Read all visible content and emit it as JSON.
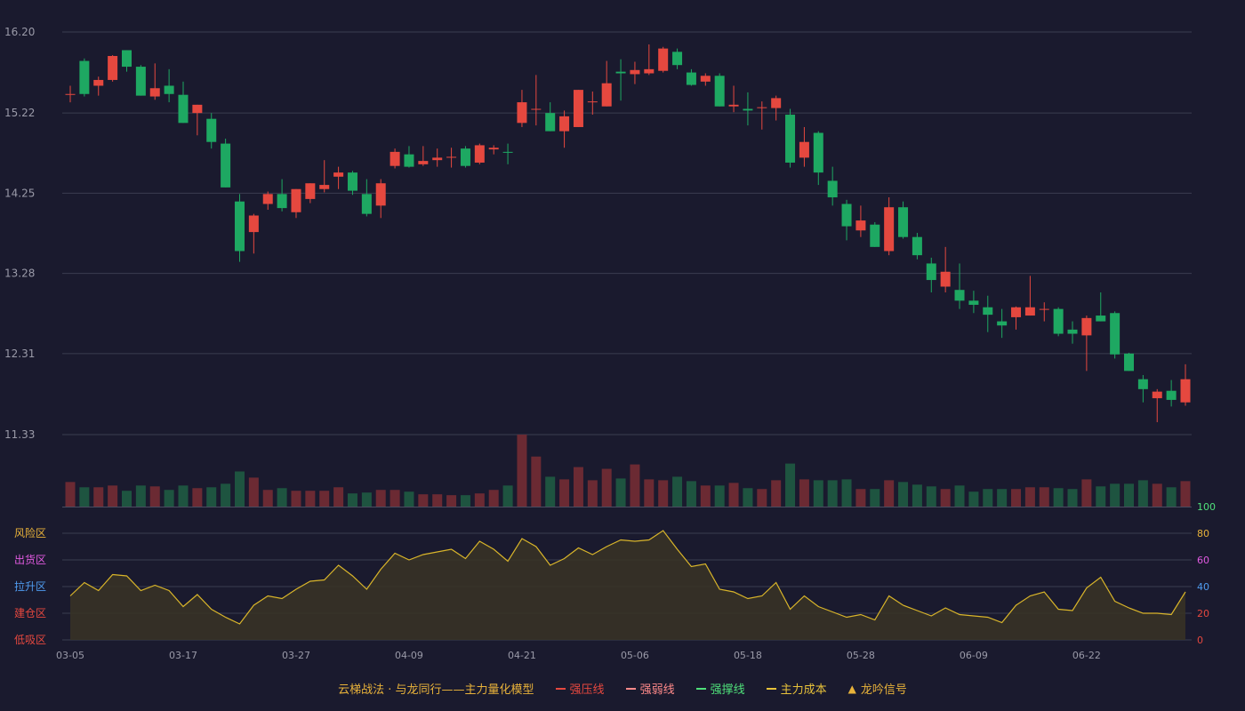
{
  "colors": {
    "background": "#1a1a2e",
    "up": "#e5483f",
    "down": "#1ea862",
    "up_volume": "#6b2a33",
    "down_volume": "#1e5440",
    "grid": "#3a3d50",
    "axis_text": "#9a9aa8",
    "indicator_line": "#d9b52a",
    "indicator_fill": "#3a3424",
    "legend_title": "#e8b23a"
  },
  "chart_data": [
    {
      "type": "candlestick",
      "ylim": [
        11.33,
        16.2
      ],
      "yticks": [
        "16.20",
        "15.22",
        "14.25",
        "13.28",
        "12.31",
        "11.33"
      ],
      "xticks": [
        "03-05",
        "03-17",
        "03-27",
        "04-09",
        "04-21",
        "05-06",
        "05-18",
        "05-28",
        "06-09",
        "06-22"
      ],
      "xtick_index": [
        0,
        8,
        16,
        24,
        32,
        40,
        48,
        56,
        64,
        72
      ],
      "candles": [
        [
          15.45,
          15.45,
          15.55,
          15.35
        ],
        [
          15.85,
          15.45,
          15.88,
          15.42
        ],
        [
          15.55,
          15.62,
          15.66,
          15.43
        ],
        [
          15.62,
          15.91,
          15.92,
          15.6
        ],
        [
          15.98,
          15.78,
          15.98,
          15.72
        ],
        [
          15.78,
          15.43,
          15.8,
          15.43
        ],
        [
          15.42,
          15.52,
          15.82,
          15.38
        ],
        [
          15.55,
          15.45,
          15.75,
          15.35
        ],
        [
          15.44,
          15.1,
          15.6,
          15.1
        ],
        [
          15.22,
          15.32,
          15.32,
          14.95
        ],
        [
          15.15,
          14.87,
          15.22,
          14.79
        ],
        [
          14.85,
          14.32,
          14.91,
          14.32
        ],
        [
          14.15,
          13.55,
          14.24,
          13.42
        ],
        [
          13.78,
          13.98,
          14.0,
          13.52
        ],
        [
          14.12,
          14.24,
          14.27,
          14.05
        ],
        [
          14.24,
          14.07,
          14.42,
          14.03
        ],
        [
          14.02,
          14.3,
          14.3,
          13.95
        ],
        [
          14.18,
          14.37,
          14.37,
          14.13
        ],
        [
          14.3,
          14.35,
          14.65,
          14.26
        ],
        [
          14.45,
          14.5,
          14.57,
          14.3
        ],
        [
          14.5,
          14.28,
          14.52,
          14.23
        ],
        [
          14.24,
          14.0,
          14.42,
          13.97
        ],
        [
          14.1,
          14.37,
          14.42,
          13.95
        ],
        [
          14.58,
          14.75,
          14.79,
          14.55
        ],
        [
          14.72,
          14.57,
          14.82,
          14.56
        ],
        [
          14.6,
          14.64,
          14.82,
          14.58
        ],
        [
          14.65,
          14.68,
          14.79,
          14.57
        ],
        [
          14.68,
          14.69,
          14.8,
          14.56
        ],
        [
          14.79,
          14.58,
          14.82,
          14.56
        ],
        [
          14.62,
          14.83,
          14.85,
          14.6
        ],
        [
          14.78,
          14.8,
          14.83,
          14.72
        ],
        [
          14.75,
          14.74,
          14.85,
          14.6
        ],
        [
          15.1,
          15.35,
          15.5,
          15.05
        ],
        [
          15.26,
          15.27,
          15.68,
          15.07
        ],
        [
          15.22,
          15.0,
          15.35,
          15.0
        ],
        [
          15.0,
          15.18,
          15.25,
          14.8
        ],
        [
          15.05,
          15.5,
          15.5,
          15.05
        ],
        [
          15.35,
          15.36,
          15.48,
          15.2
        ],
        [
          15.3,
          15.58,
          15.85,
          15.3
        ],
        [
          15.72,
          15.7,
          15.87,
          15.37
        ],
        [
          15.69,
          15.74,
          15.84,
          15.57
        ],
        [
          15.7,
          15.75,
          16.05,
          15.68
        ],
        [
          15.73,
          16.0,
          16.02,
          15.71
        ],
        [
          15.96,
          15.8,
          16.0,
          15.75
        ],
        [
          15.71,
          15.56,
          15.75,
          15.55
        ],
        [
          15.6,
          15.67,
          15.7,
          15.55
        ],
        [
          15.67,
          15.3,
          15.7,
          15.3
        ],
        [
          15.3,
          15.32,
          15.55,
          15.23
        ],
        [
          15.27,
          15.25,
          15.47,
          15.07
        ],
        [
          15.28,
          15.29,
          15.36,
          15.02
        ],
        [
          15.28,
          15.4,
          15.43,
          15.13
        ],
        [
          15.2,
          14.62,
          15.27,
          14.56
        ],
        [
          14.68,
          14.87,
          15.05,
          14.57
        ],
        [
          14.98,
          14.5,
          15.0,
          14.35
        ],
        [
          14.4,
          14.2,
          14.57,
          14.1
        ],
        [
          14.12,
          13.85,
          14.17,
          13.68
        ],
        [
          13.8,
          13.92,
          14.1,
          13.72
        ],
        [
          13.87,
          13.6,
          13.9,
          13.6
        ],
        [
          13.55,
          14.08,
          14.2,
          13.5
        ],
        [
          14.08,
          13.72,
          14.15,
          13.7
        ],
        [
          13.72,
          13.5,
          13.77,
          13.45
        ],
        [
          13.4,
          13.2,
          13.47,
          13.05
        ],
        [
          13.12,
          13.3,
          13.6,
          13.05
        ],
        [
          13.08,
          12.95,
          13.4,
          12.85
        ],
        [
          12.95,
          12.9,
          13.07,
          12.8
        ],
        [
          12.87,
          12.78,
          13.01,
          12.57
        ],
        [
          12.7,
          12.65,
          12.85,
          12.5
        ],
        [
          12.75,
          12.87,
          12.88,
          12.6
        ],
        [
          12.77,
          12.87,
          13.25,
          12.77
        ],
        [
          12.85,
          12.85,
          12.93,
          12.7
        ],
        [
          12.85,
          12.55,
          12.87,
          12.52
        ],
        [
          12.6,
          12.55,
          12.7,
          12.43
        ],
        [
          12.53,
          12.74,
          12.77,
          12.1
        ],
        [
          12.77,
          12.7,
          13.05,
          12.7
        ],
        [
          12.8,
          12.3,
          12.82,
          12.25
        ],
        [
          12.31,
          12.1,
          12.32,
          12.1
        ],
        [
          12.0,
          11.88,
          12.05,
          11.72
        ],
        [
          11.77,
          11.85,
          11.88,
          11.48
        ],
        [
          11.86,
          11.75,
          11.99,
          11.67
        ],
        [
          11.72,
          12.0,
          12.18,
          11.68
        ]
      ]
    },
    {
      "type": "bar",
      "title": "",
      "ylim": [
        0,
        82
      ],
      "values": [
        28,
        22,
        22,
        24,
        18,
        24,
        23,
        19,
        24,
        21,
        22,
        26,
        40,
        33,
        19,
        21,
        18,
        18,
        18,
        22,
        15,
        16,
        19,
        19,
        17,
        14,
        14,
        13,
        13,
        15,
        19,
        24,
        82,
        57,
        34,
        31,
        45,
        30,
        43,
        32,
        48,
        31,
        30,
        34,
        29,
        24,
        24,
        27,
        21,
        20,
        30,
        49,
        31,
        30,
        30,
        31,
        20,
        20,
        30,
        28,
        25,
        23,
        20,
        24,
        17,
        20,
        20,
        20,
        22,
        22,
        21,
        20,
        31,
        23,
        26,
        26,
        30,
        26,
        22,
        29
      ]
    },
    {
      "type": "line",
      "ylim": [
        0,
        100
      ],
      "yticks": [
        "100",
        "80",
        "60",
        "40",
        "20",
        "0"
      ],
      "zone_labels": [
        "风险区",
        "出货区",
        "拉升区",
        "建仓区",
        "低吸区"
      ],
      "values": [
        33,
        43,
        37,
        49,
        48,
        37,
        41,
        37,
        25,
        34,
        23,
        17,
        12,
        26,
        33,
        31,
        38,
        44,
        45,
        56,
        48,
        38,
        53,
        65,
        60,
        64,
        66,
        68,
        61,
        74,
        68,
        59,
        76,
        70,
        56,
        61,
        69,
        64,
        70,
        75,
        74,
        75,
        82,
        68,
        55,
        57,
        38,
        36,
        31,
        33,
        43,
        23,
        33,
        25,
        21,
        17,
        19,
        15,
        33,
        26,
        22,
        18,
        24,
        19,
        18,
        17,
        13,
        26,
        33,
        36,
        23,
        22,
        39,
        47,
        29,
        24,
        20,
        20,
        19,
        36
      ]
    }
  ],
  "legend": {
    "title": "云梯战法 · 与龙同行——主力量化模型",
    "items": [
      {
        "label": "强压线",
        "color": "#e5483f",
        "style": "solid"
      },
      {
        "label": "强弱线",
        "color": "#ff8a8a",
        "style": "dashed"
      },
      {
        "label": "强撑线",
        "color": "#4fe07a",
        "style": "solid"
      },
      {
        "label": "主力成本",
        "color": "#e8c23a",
        "style": "dashed"
      },
      {
        "label": "龙吟信号",
        "color": "#e8b23a",
        "style": "triangle",
        "icon": "▲"
      }
    ]
  }
}
